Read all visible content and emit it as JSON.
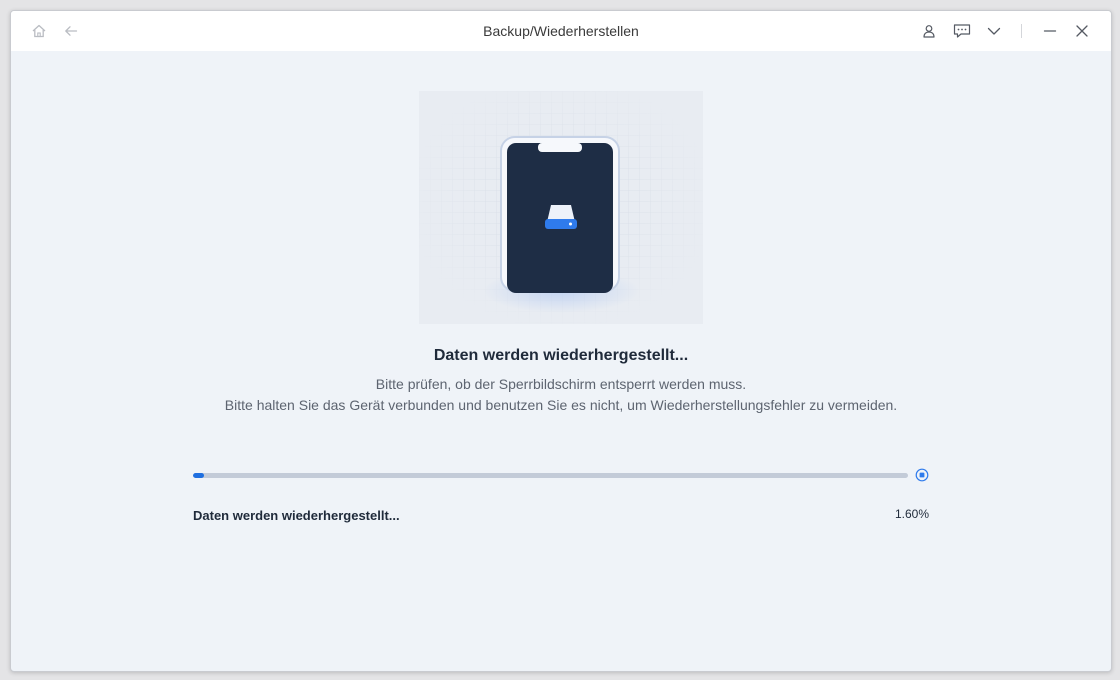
{
  "window": {
    "title": "Backup/Wiederherstellen"
  },
  "titlebar": {
    "left_icons": [
      "home-icon",
      "back-arrow-icon"
    ],
    "right_icons": [
      "user-icon",
      "feedback-chat-icon",
      "chevron-down-icon",
      "minimize-icon",
      "close-icon"
    ]
  },
  "illustration": {
    "icon": "hard-drive-icon"
  },
  "main": {
    "heading": "Daten werden wiederhergestellt...",
    "description_line1": "Bitte prüfen, ob der Sperrbildschirm entsperrt werden muss.",
    "description_line2": "Bitte halten Sie das Gerät verbunden und benutzen Sie es nicht, um Wiederherstellungsfehler zu vermeiden."
  },
  "progress": {
    "percent": 1.6,
    "percent_label": "1.60%",
    "status_label": "Daten werden wiederhergestellt..."
  },
  "colors": {
    "accent": "#1f6fe0",
    "track": "#c3cbd8",
    "background": "#eff3f8",
    "phone_screen": "#1e2d45"
  }
}
